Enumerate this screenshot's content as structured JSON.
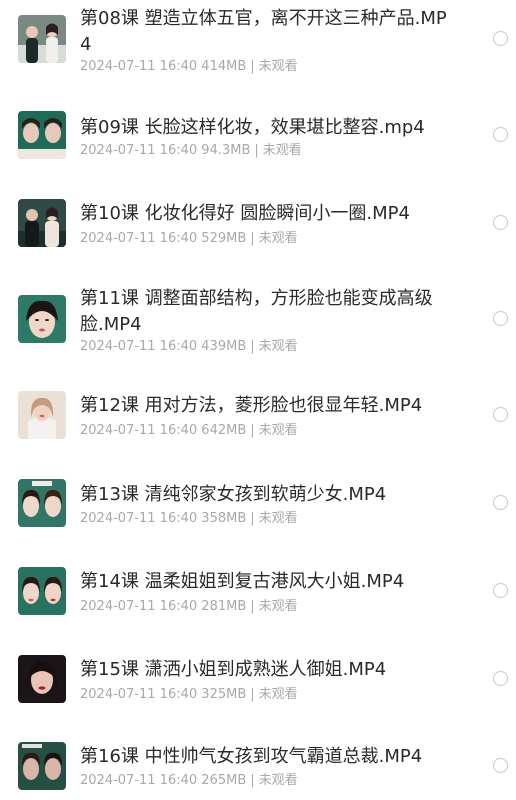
{
  "files": [
    {
      "title": "第08课 塑造立体五官，离不开这三种产品.MP4",
      "date": "2024-07-11 16:40",
      "size": "414MB",
      "status": "未观看",
      "thumb_bg": "#7a8a83",
      "thumb_accent": "#1d2a2a",
      "thumb_icon": "video-thumbnail-two-presenters"
    },
    {
      "title": "第09课 长脸这样化妆，效果堪比整容.mp4",
      "date": "2024-07-11 16:40",
      "size": "94.3MB",
      "status": "未观看",
      "thumb_bg": "#1e6b5a",
      "thumb_accent": "#e8c8b8",
      "thumb_icon": "video-thumbnail-face-comparison"
    },
    {
      "title": "第10课 化妆化得好 圆脸瞬间小一圈.MP4",
      "date": "2024-07-11 16:40",
      "size": "529MB",
      "status": "未观看",
      "thumb_bg": "#2f4a44",
      "thumb_accent": "#f1e4dc",
      "thumb_icon": "video-thumbnail-two-presenters"
    },
    {
      "title": "第11课 调整面部结构，方形脸也能变成高级脸.MP4",
      "date": "2024-07-11 16:40",
      "size": "439MB",
      "status": "未观看",
      "thumb_bg": "#2c7a67",
      "thumb_accent": "#efd7c9",
      "thumb_icon": "video-thumbnail-face"
    },
    {
      "title": "第12课 用对方法，菱形脸也很显年轻.MP4",
      "date": "2024-07-11 16:40",
      "size": "642MB",
      "status": "未观看",
      "thumb_bg": "#e9e1d6",
      "thumb_accent": "#c79a7f",
      "thumb_icon": "video-thumbnail-presenter"
    },
    {
      "title": "第13课 清纯邻家女孩到软萌少女.MP4",
      "date": "2024-07-11 16:40",
      "size": "358MB",
      "status": "未观看",
      "thumb_bg": "#2f7666",
      "thumb_accent": "#efd8cb",
      "thumb_icon": "video-thumbnail-face-comparison"
    },
    {
      "title": "第14课 温柔姐姐到复古港风大小姐.MP4",
      "date": "2024-07-11 16:40",
      "size": "281MB",
      "status": "未观看",
      "thumb_bg": "#277260",
      "thumb_accent": "#efd5c8",
      "thumb_icon": "video-thumbnail-face-comparison"
    },
    {
      "title": "第15课 潇洒小姐到成熟迷人御姐.MP4",
      "date": "2024-07-11 16:40",
      "size": "325MB",
      "status": "未观看",
      "thumb_bg": "#1b1418",
      "thumb_accent": "#e9c4b6",
      "thumb_icon": "video-thumbnail-face"
    },
    {
      "title": "第16课 中性帅气女孩到攻气霸道总裁.MP4",
      "date": "2024-07-11 16:40",
      "size": "265MB",
      "status": "未观看",
      "thumb_bg": "#254f45",
      "thumb_accent": "#d9b6a6",
      "thumb_icon": "video-thumbnail-face-comparison"
    }
  ]
}
